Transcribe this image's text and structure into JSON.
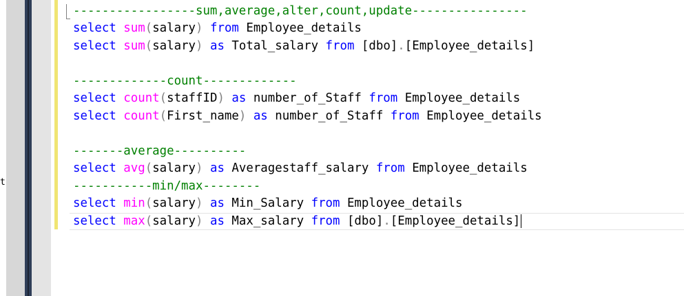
{
  "left_panel": {
    "clipped_text": "t"
  },
  "editor": {
    "lines": [
      {
        "id": "l1",
        "tokens": [
          {
            "c": "cm",
            "t": "-----------------sum,average,alter,count,update----------------"
          }
        ]
      },
      {
        "id": "l2",
        "tokens": [
          {
            "c": "kw",
            "t": "select "
          },
          {
            "c": "fn",
            "t": "sum"
          },
          {
            "c": "pn",
            "t": "("
          },
          {
            "c": "tx",
            "t": "salary"
          },
          {
            "c": "pn",
            "t": ")"
          },
          {
            "c": "tx",
            "t": " "
          },
          {
            "c": "kw",
            "t": "from"
          },
          {
            "c": "tx",
            "t": " Employee_details"
          }
        ]
      },
      {
        "id": "l3",
        "tokens": [
          {
            "c": "kw",
            "t": "select "
          },
          {
            "c": "fn",
            "t": "sum"
          },
          {
            "c": "pn",
            "t": "("
          },
          {
            "c": "tx",
            "t": "salary"
          },
          {
            "c": "pn",
            "t": ")"
          },
          {
            "c": "tx",
            "t": " "
          },
          {
            "c": "kw",
            "t": "as"
          },
          {
            "c": "tx",
            "t": " Total_salary "
          },
          {
            "c": "kw",
            "t": "from"
          },
          {
            "c": "tx",
            "t": " [dbo]"
          },
          {
            "c": "pn",
            "t": "."
          },
          {
            "c": "tx",
            "t": "[Employee_details]"
          }
        ]
      },
      {
        "id": "l4",
        "tokens": []
      },
      {
        "id": "l5",
        "tokens": [
          {
            "c": "cm",
            "t": "-------------count-------------"
          }
        ]
      },
      {
        "id": "l6",
        "tokens": [
          {
            "c": "kw",
            "t": "select "
          },
          {
            "c": "fn",
            "t": "count"
          },
          {
            "c": "pn",
            "t": "("
          },
          {
            "c": "tx",
            "t": "staffID"
          },
          {
            "c": "pn",
            "t": ")"
          },
          {
            "c": "tx",
            "t": " "
          },
          {
            "c": "kw",
            "t": "as"
          },
          {
            "c": "tx",
            "t": " number_of_Staff "
          },
          {
            "c": "kw",
            "t": "from"
          },
          {
            "c": "tx",
            "t": " Employee_details"
          }
        ]
      },
      {
        "id": "l7",
        "tokens": [
          {
            "c": "kw",
            "t": "select "
          },
          {
            "c": "fn",
            "t": "count"
          },
          {
            "c": "pn",
            "t": "("
          },
          {
            "c": "tx",
            "t": "First_name"
          },
          {
            "c": "pn",
            "t": ")"
          },
          {
            "c": "tx",
            "t": " "
          },
          {
            "c": "kw",
            "t": "as"
          },
          {
            "c": "tx",
            "t": " number_of_Staff "
          },
          {
            "c": "kw",
            "t": "from"
          },
          {
            "c": "tx",
            "t": " Employee_details"
          }
        ]
      },
      {
        "id": "l8",
        "tokens": []
      },
      {
        "id": "l9",
        "tokens": [
          {
            "c": "cm",
            "t": "-------average----------"
          }
        ]
      },
      {
        "id": "l10",
        "tokens": [
          {
            "c": "kw",
            "t": "select "
          },
          {
            "c": "fn",
            "t": "avg"
          },
          {
            "c": "pn",
            "t": "("
          },
          {
            "c": "tx",
            "t": "salary"
          },
          {
            "c": "pn",
            "t": ")"
          },
          {
            "c": "tx",
            "t": " "
          },
          {
            "c": "kw",
            "t": "as"
          },
          {
            "c": "tx",
            "t": " Averagestaff_salary "
          },
          {
            "c": "kw",
            "t": "from"
          },
          {
            "c": "tx",
            "t": " Employee_details"
          }
        ]
      },
      {
        "id": "l11",
        "tokens": [
          {
            "c": "cm",
            "t": "-----------min/max--------"
          }
        ]
      },
      {
        "id": "l12",
        "tokens": [
          {
            "c": "kw",
            "t": "select "
          },
          {
            "c": "fn",
            "t": "min"
          },
          {
            "c": "pn",
            "t": "("
          },
          {
            "c": "tx",
            "t": "salary"
          },
          {
            "c": "pn",
            "t": ")"
          },
          {
            "c": "tx",
            "t": " "
          },
          {
            "c": "kw",
            "t": "as"
          },
          {
            "c": "tx",
            "t": " Min_Salary "
          },
          {
            "c": "kw",
            "t": "from"
          },
          {
            "c": "tx",
            "t": " Employee_details"
          }
        ]
      },
      {
        "id": "l13",
        "tokens": [
          {
            "c": "kw",
            "t": "select "
          },
          {
            "c": "fn",
            "t": "max"
          },
          {
            "c": "pn",
            "t": "("
          },
          {
            "c": "tx",
            "t": "salary"
          },
          {
            "c": "pn",
            "t": ")"
          },
          {
            "c": "tx",
            "t": " "
          },
          {
            "c": "kw",
            "t": "as"
          },
          {
            "c": "tx",
            "t": " Max_salary "
          },
          {
            "c": "kw",
            "t": "from"
          },
          {
            "c": "tx",
            "t": " [dbo]"
          },
          {
            "c": "pn",
            "t": "."
          },
          {
            "c": "tx",
            "t": "[Employee_details]"
          }
        ]
      }
    ]
  },
  "colors": {
    "keyword": "#0000ff",
    "function": "#ff00ff",
    "comment": "#008000",
    "punctuation": "#808080",
    "text": "#000000"
  }
}
